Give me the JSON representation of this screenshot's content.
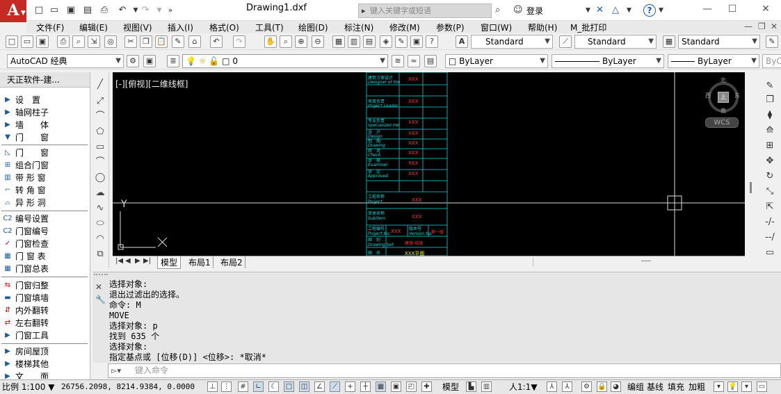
{
  "app": {
    "logo": "A",
    "title": "Drawing1.dxf",
    "search_placeholder": "键入关键字或短语",
    "login_label": "登录",
    "help_label": "?"
  },
  "menubar": [
    "文件(F)",
    "编辑(E)",
    "视图(V)",
    "插入(I)",
    "格式(O)",
    "工具(T)",
    "绘图(D)",
    "标注(N)",
    "修改(M)",
    "参数(P)",
    "窗口(W)",
    "帮助(H)",
    "M_批打印"
  ],
  "styles": {
    "text_style": "Standard",
    "dim_style": "Standard",
    "table_style": "Standard"
  },
  "workspace": {
    "name": "AutoCAD 经典"
  },
  "layer": {
    "name": "0"
  },
  "properties": {
    "color": "ByLayer",
    "linetype": "ByLayer",
    "lineweight": "ByLayer",
    "plotstyle": "ByCo"
  },
  "leftpanel": {
    "title": "天正软件-建...",
    "categories": [
      "设　置",
      "轴网柱子",
      "墙　　体",
      "门　　窗"
    ],
    "items_a": [
      "门　　窗",
      "组合门窗",
      "带 形 窗",
      "转 角 窗",
      "异 形 洞"
    ],
    "items_b": [
      "编号设置",
      "门窗编号",
      "门窗检查",
      "门 窗 表",
      "门窗总表"
    ],
    "items_c": [
      "门窗归整",
      "门窗填墙",
      "内外翻转",
      "左右翻转",
      "门窗工具"
    ],
    "items_d": [
      "房间屋顶",
      "楼梯其他",
      "文　　面"
    ]
  },
  "viewport": {
    "label": "[-][俯视][二维线框]",
    "compass": {
      "n": "北",
      "s": "南",
      "e": "东",
      "w": "西",
      "center": "上"
    },
    "wcs": "WCS",
    "ucs_y": "Y"
  },
  "titleblock": {
    "rows": [
      {
        "cn": "建筑方案设计",
        "en": "Designer of the Architectural Project",
        "v": "XXX"
      },
      {
        "cn": "项目负责",
        "en": "Project Leader",
        "v": "XXX"
      },
      {
        "cn": "专业负责",
        "en": "Specialized Person in Charge",
        "v": "XXX"
      },
      {
        "cn": "设　计",
        "en": "Design",
        "v": "XXX"
      },
      {
        "cn": "制　图",
        "en": "Drawing",
        "v": "XXX"
      },
      {
        "cn": "校　对",
        "en": "Check",
        "v": "XXX"
      },
      {
        "cn": "审　核",
        "en": "Examiner",
        "v": "XXX"
      },
      {
        "cn": "审　定",
        "en": "Approved",
        "v": "XXX"
      }
    ],
    "project_name_cn": "工程名称",
    "project_name_en": "Project",
    "project_name_v": "XXX",
    "subitem_cn": "单体名称",
    "subitem_en": "Subitem",
    "subitem_v": "XXX",
    "project_no_cn": "工程编号",
    "project_no_en": "Project No.",
    "project_no_v": "XXX",
    "version_cn": "版本号",
    "version_en": "Version No.",
    "version_v": "第一版",
    "sheet_cn": "图　别",
    "sheet_en": "Drawing Set",
    "sheet_v": "建施-结施",
    "name_cn": "图　名",
    "name_v": "XXX平面"
  },
  "tabs": [
    "模型",
    "布局1",
    "布局2"
  ],
  "command_history": [
    "选择对象:",
    "退出过滤出的选择。",
    "命令: M",
    "MOVE",
    "选择对象: p",
    "找到 635 个",
    "选择对象:",
    "指定基点或 [位移(D)] <位移>: *取消*"
  ],
  "command_placeholder": "键入命令",
  "statusbar": {
    "scale": "比例 1:100 ▼",
    "coords": "26756.2098, 8214.9384, 0.0000",
    "model": "模型",
    "annotation": "人1:1▼",
    "btn_group": "编组",
    "btn_baseline": "基线",
    "btn_fill": "填充",
    "btn_thicken": "加粗"
  }
}
